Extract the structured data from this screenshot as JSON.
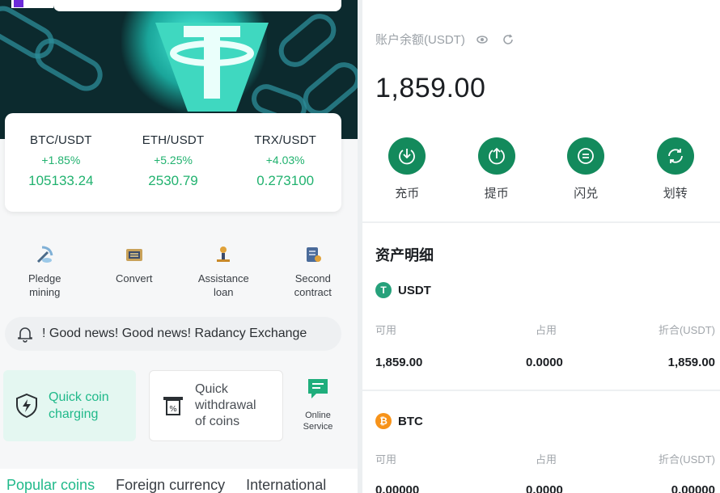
{
  "tickers": [
    {
      "pair": "BTC/USDT",
      "change": "+1.85%",
      "price": "105133.24"
    },
    {
      "pair": "ETH/USDT",
      "change": "+5.25%",
      "price": "2530.79"
    },
    {
      "pair": "TRX/USDT",
      "change": "+4.03%",
      "price": "0.273100"
    }
  ],
  "quick_menu": [
    {
      "label1": "Pledge",
      "label2": "mining",
      "icon": "pickaxe-icon"
    },
    {
      "label1": "Convert",
      "label2": "",
      "icon": "exchange-icon"
    },
    {
      "label1": "Assistance",
      "label2": "loan",
      "icon": "loan-icon"
    },
    {
      "label1": "Second",
      "label2": "contract",
      "icon": "contract-icon"
    }
  ],
  "notice": {
    "text": "! Good news! Good news! Radancy Exchange"
  },
  "actions": {
    "quick_charge": {
      "line1": "Quick coin",
      "line2": "charging"
    },
    "quick_withdraw": {
      "line1": "Quick",
      "line2": "withdrawal",
      "line3": "of coins"
    },
    "online_service": {
      "line1": "Online",
      "line2": "Service"
    }
  },
  "tabs": [
    "Popular coins",
    "Foreign currency",
    "International"
  ],
  "wallet": {
    "balance_label": "账户余额(USDT)",
    "balance": "1,859.00",
    "buttons": [
      {
        "label": "充币",
        "icon": "deposit-icon"
      },
      {
        "label": "提币",
        "icon": "withdraw-icon"
      },
      {
        "label": "闪兑",
        "icon": "flash-exchange-icon"
      },
      {
        "label": "划转",
        "icon": "transfer-icon"
      }
    ],
    "section_title": "资产明细",
    "column_headers": [
      "可用",
      "占用",
      "折合(USDT)"
    ],
    "assets": [
      {
        "name": "USDT",
        "available": "1,859.00",
        "occupied": "0.0000",
        "equivalent": "1,859.00",
        "color": "#26a17b"
      },
      {
        "name": "BTC",
        "available": "0.00000",
        "occupied": "0.0000",
        "equivalent": "0.00000",
        "color": "#f7931a"
      }
    ]
  },
  "colors": {
    "accent_green": "#21b26f",
    "button_green": "#138a5c",
    "teal": "#20b98a"
  }
}
